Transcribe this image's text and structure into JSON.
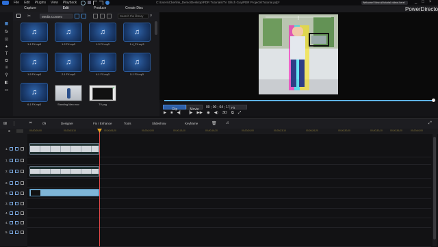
{
  "app": {
    "brand": "PowerDirector",
    "doc_path": "C:\\Users\\Cberlink_Demo\\Desktop\\PDR Tutorials\\TV Glitch Guy\\PDR Projects\\Tutorial.pdp*",
    "notice": "Welcome! View all tutorial videos here!"
  },
  "menu": [
    "File",
    "Edit",
    "Plugins",
    "View",
    "Playback"
  ],
  "window_controls": [
    "_",
    "□",
    "×"
  ],
  "mode_tabs": {
    "capture": "Capture",
    "edit": "Edit",
    "produce": "Produce",
    "create_disc": "Create Disc"
  },
  "library": {
    "filter": "Media Content",
    "search_placeholder": "Search the library",
    "items": [
      {
        "caption": "1-1 FX.mp3",
        "kind": "audio"
      },
      {
        "caption": "1-2 FX.mp3",
        "kind": "audio"
      },
      {
        "caption": "1-3 FX.mp3",
        "kind": "audio"
      },
      {
        "caption": "1-4_FX.mp3",
        "kind": "audio"
      },
      {
        "caption": "1-5 FX.mp3",
        "kind": "audio"
      },
      {
        "caption": "2-1 FX.mp3",
        "kind": "audio"
      },
      {
        "caption": "4-1 FX.mp3",
        "kind": "audio"
      },
      {
        "caption": "5-1 FX.mp3",
        "kind": "audio"
      },
      {
        "caption": "6-1 FX.mp3",
        "kind": "audio"
      },
      {
        "caption": "Standing Man.mov",
        "kind": "video"
      },
      {
        "caption": "TV.png",
        "kind": "image"
      }
    ]
  },
  "preview": {
    "clip_label": "Clip",
    "movie_label": "Movie",
    "timecode": "00 ; 00 ; 04 ; 17",
    "fit": "Fit",
    "mode_3d": "3D"
  },
  "timeline_toolbar": {
    "designer": "Designer",
    "fix_enhance": "Fix / Enhance",
    "tools": "Tools",
    "slideshow": "Slideshow",
    "keyframe": "Keyframe"
  },
  "ruler": [
    "00;00;00;00",
    "00;00;03;10",
    "00;00;06;20",
    "00;00;10;00",
    "00;00;13;10",
    "00;00;16;20",
    "00;00;20;00",
    "00;00;23;10",
    "00;00;26;20",
    "00;00;30;00",
    "00;00;33;10",
    "00;00;36;20",
    "00;00;40;00",
    "00;00;43;10"
  ],
  "tracks": [
    {
      "num": "1.",
      "type": "video"
    },
    {
      "num": "1.",
      "type": "audio"
    },
    {
      "num": "2.",
      "type": "video"
    },
    {
      "num": "2.",
      "type": "audio"
    },
    {
      "num": "3.",
      "type": "video"
    },
    {
      "num": "3.",
      "type": "audio"
    },
    {
      "num": "4.",
      "type": "video"
    },
    {
      "num": "4.",
      "type": "audio"
    },
    {
      "num": "5.",
      "type": "video"
    }
  ]
}
